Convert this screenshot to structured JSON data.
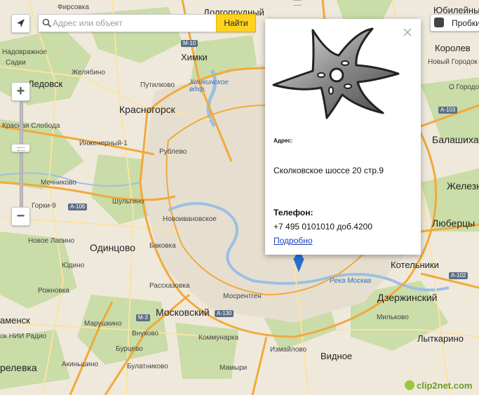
{
  "search": {
    "placeholder": "Адрес или объект",
    "button_label": "Найти"
  },
  "controls": {
    "zoom_in": "+",
    "zoom_out": "−",
    "traffic_label": "Пробки"
  },
  "balloon": {
    "address_label": "Адрес:",
    "address": "Сколковское шоссе 20 стр.9",
    "phone_label": "Телефон:",
    "phone": "+7 495 0101010 доб.4200",
    "details_link": "Подробно"
  },
  "map_labels": {
    "fursovka": "Фирсовка",
    "dolgoprudny": "Долгопрудный",
    "yubileyny": "Юбилейный",
    "nadovrazhnoe": "Надовражное",
    "sadki": "Садки",
    "khimki": "Химки",
    "m10": "М-10",
    "korolev": "Королев",
    "zhelyabino": "Желябино",
    "novy_gorodok": "Новый Городок",
    "ledovsk": "Ледовск",
    "putilkovo": "Путилково",
    "khimkinskoe": "Химкинское вдхр.",
    "ogorodok": "О Городок",
    "krasnogorsk": "Красногорск",
    "a103": "А-103",
    "kraskaya_sloboda": "Красная Слобода",
    "balashikha": "Балашиха",
    "inzhenerny": "Инженерный-1",
    "rublevo": "Рублево",
    "mechnikovo": "Мечниково",
    "zhelezno": "Железно",
    "shulgino": "Шульгино",
    "gorki9": "Горки-9",
    "a106": "А-106",
    "novoivanovskoe": "Новоивановское",
    "lyubertsy": "Люберцы",
    "novoe_lapino": "Новое Лапино",
    "odintsovo": "Одинцово",
    "bakovka": "Баковка",
    "kotelniki": "Котельники",
    "yudino": "Юдино",
    "a102": "А-102",
    "reka_moskva": "Река Москва",
    "rozhnovka": "Рожновка",
    "rasskazovka": "Рассказовка",
    "dzerzhinsky": "Дзержинский",
    "mosrentgen": "Мосрентген",
    "kamensk": "аменск",
    "m3": "М-3",
    "moskovsky": "Московский",
    "a130": "А-130",
    "milkovo": "Мильково",
    "marushkino": "Марушкино",
    "lytkarino": "Лыткарино",
    "nii_radio": "ок НИИ Радио",
    "vnukovo": "Внуково",
    "kommunarka": "Коммунарка",
    "izmaylovo": "Измайлово",
    "vidnoe": "Видное",
    "burtsevo": "Бурцево",
    "akinshino": "Акиньшино",
    "mamyri": "Мамыри",
    "bulatnikovo": "Булатниково",
    "relevka": "релевка",
    "clip2net": "clip2net.com"
  },
  "colors": {
    "road_major": "#f2a93b",
    "road_minor": "#fbe3a3",
    "forest": "#c7dba2",
    "water": "#b6d1ec",
    "search_button": "#ffd21e"
  }
}
